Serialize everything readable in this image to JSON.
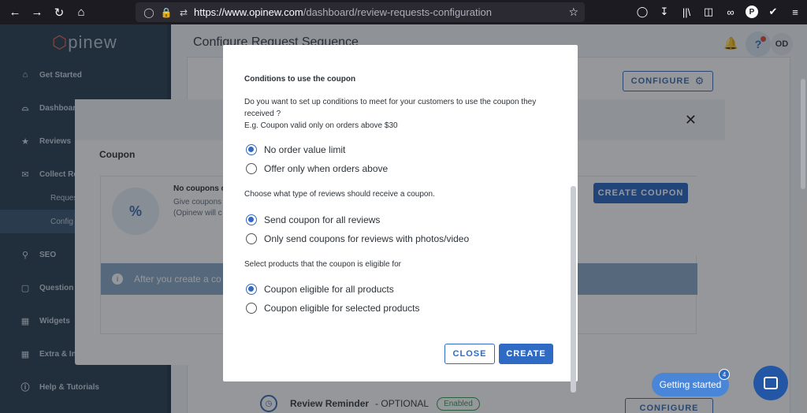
{
  "browser": {
    "url_host": "https://www.opinew.com",
    "url_path": "/dashboard/review-requests-configuration"
  },
  "sidebar": {
    "logo": "pinew",
    "items": [
      {
        "label": "Get Started",
        "icon": "home-icon"
      },
      {
        "label": "Dashboard",
        "icon": "chart-icon"
      },
      {
        "label": "Reviews",
        "icon": "star-icon"
      },
      {
        "label": "Collect Re",
        "icon": "collect-icon"
      },
      {
        "label": "Reques",
        "icon": ""
      },
      {
        "label": "Config",
        "icon": ""
      },
      {
        "label": "SEO",
        "icon": "search-icon"
      },
      {
        "label": "Question",
        "icon": "question-icon"
      },
      {
        "label": "Widgets",
        "icon": "widgets-icon"
      },
      {
        "label": "Extra & Integrations",
        "icon": "puzzle-icon"
      },
      {
        "label": "Help & Tutorials",
        "icon": "help-icon"
      }
    ]
  },
  "header": {
    "title": "Configure Request Sequence",
    "avatar": "OD"
  },
  "background": {
    "configure_label": "CONFIGURE",
    "review_reminder": "Review Reminder",
    "optional": "- OPTIONAL",
    "enabled": "Enabled",
    "configure_bottom": "CONFIGURE"
  },
  "coupon_dialog": {
    "title": "Coupon",
    "no_coupons": "No coupons c",
    "give_coupons_1": "Give coupons",
    "give_coupons_2": "(Opinew will c",
    "create_coupon": "CREATE COUPON",
    "info_text": "After you create a co"
  },
  "conditions_dialog": {
    "title": "Conditions to use the coupon",
    "question": "Do you want to set up conditions to meet for your customers to use the coupon they received ?",
    "example": "E.g. Coupon valid only on orders above $30",
    "order_options": [
      {
        "label": "No order value limit",
        "checked": true
      },
      {
        "label": "Offer only when orders above",
        "checked": false
      }
    ],
    "review_type_label": "Choose what type of reviews should receive a coupon.",
    "review_options": [
      {
        "label": "Send coupon for all reviews",
        "checked": true
      },
      {
        "label": "Only send coupons for reviews with photos/video",
        "checked": false
      }
    ],
    "products_label": "Select products that the coupon is eligible for",
    "product_options": [
      {
        "label": "Coupon eligible for all products",
        "checked": true
      },
      {
        "label": "Coupon eligible for selected products",
        "checked": false
      }
    ],
    "close_label": "CLOSE",
    "create_label": "CREATE"
  },
  "widgets": {
    "getting_started": "Getting started",
    "getting_started_badge": "4"
  },
  "colors": {
    "primary": "#2f6bc4",
    "sidebar": "#2c4257",
    "sidebar_active": "#3c5873"
  }
}
